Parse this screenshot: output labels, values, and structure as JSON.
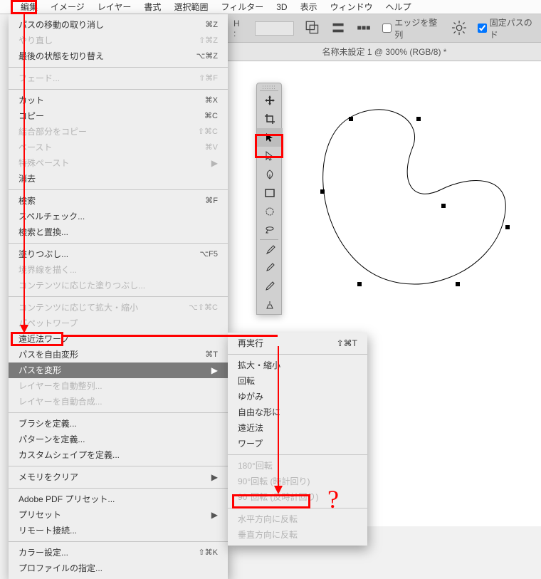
{
  "menubar": {
    "items": [
      "編集",
      "イメージ",
      "レイヤー",
      "書式",
      "選択範囲",
      "フィルター",
      "3D",
      "表示",
      "ウィンドウ",
      "ヘルプ"
    ]
  },
  "optbar": {
    "h_label": "H :",
    "edge_label": "エッジを整列",
    "fixpath_label": "固定パスのド"
  },
  "doc_title": "名称未設定 1 @ 300% (RGB/8) *",
  "editmenu": {
    "undo": "パスの移動の取り消し",
    "undo_k": "⌘Z",
    "redo": "やり直し",
    "redo_k": "⇧⌘Z",
    "toggle": "最後の状態を切り替え",
    "toggle_k": "⌥⌘Z",
    "fade": "フェード...",
    "fade_k": "⇧⌘F",
    "cut": "カット",
    "cut_k": "⌘X",
    "copy": "コピー",
    "copy_k": "⌘C",
    "copymerged": "結合部分をコピー",
    "copymerged_k": "⇧⌘C",
    "paste": "ペースト",
    "paste_k": "⌘V",
    "pastesp": "特殊ペースト",
    "clear": "消去",
    "search": "検索",
    "search_k": "⌘F",
    "spell": "スペルチェック...",
    "findrep": "検索と置換...",
    "fill": "塗りつぶし...",
    "fill_k": "⌥F5",
    "stroke": "境界線を描く...",
    "cafill": "コンテンツに応じた塗りつぶし...",
    "cascale": "コンテンツに応じて拡大・縮小",
    "cascale_k": "⌥⇧⌘C",
    "puppet": "パペットワープ",
    "persp": "遠近法ワープ",
    "freet": "パスを自由変形",
    "freet_k": "⌘T",
    "tpath": "パスを変形",
    "autoalign": "レイヤーを自動整列...",
    "autoblend": "レイヤーを自動合成...",
    "defbrush": "ブラシを定義...",
    "defpat": "パターンを定義...",
    "defshape": "カスタムシェイプを定義...",
    "purge": "メモリをクリア",
    "pdfpreset": "Adobe PDF プリセット...",
    "preset": "プリセット",
    "remote": "リモート接続...",
    "colorset": "カラー設定...",
    "colorset_k": "⇧⌘K",
    "assignprof": "プロファイルの指定..."
  },
  "submenu": {
    "again": "再実行",
    "again_k": "⇧⌘T",
    "scale": "拡大・縮小",
    "rotate": "回転",
    "skew": "ゆがみ",
    "distort": "自由な形に",
    "persp": "遠近法",
    "warp": "ワープ",
    "r180": "180°回転",
    "r90cw": "90°回転 (時計回り)",
    "r90ccw": "90°回転 (反時計回り)",
    "fliph": "水平方向に反転",
    "flipv": "垂直方向に反転"
  },
  "annotations": {
    "question": "?"
  },
  "tools": {
    "move": "move-icon",
    "crop": "crop-icon",
    "path": "path-select-icon",
    "direct": "direct-select-icon",
    "pen": "pen-icon",
    "rect": "rectangle-icon",
    "ellipse": "ellipse-icon",
    "lasso": "lasso-icon",
    "brush": "brush-icon",
    "eyedrop": "eyedropper-icon",
    "pencil": "pencil-icon",
    "clone": "clone-icon"
  }
}
